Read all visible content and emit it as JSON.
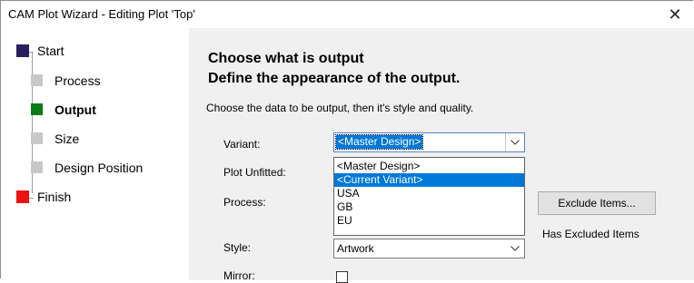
{
  "window": {
    "title": "CAM Plot Wizard - Editing Plot 'Top'",
    "close_glyph": "✕"
  },
  "steps": [
    {
      "label": "Start",
      "color": "#2a1f5e",
      "bold": false
    },
    {
      "label": "Process",
      "color": "#c8c8c8",
      "bold": false
    },
    {
      "label": "Output",
      "color": "#0a7a16",
      "bold": true
    },
    {
      "label": "Size",
      "color": "#c8c8c8",
      "bold": false
    },
    {
      "label": "Design Position",
      "color": "#c8c8c8",
      "bold": false
    },
    {
      "label": "Finish",
      "color": "#ee1111",
      "bold": false
    }
  ],
  "main": {
    "heading1": "Choose what is output",
    "heading2": "Define the appearance of the output.",
    "description": "Choose the data to be output, then it's style and quality."
  },
  "form": {
    "variant_label": "Variant:",
    "variant_value": "<Master Design>",
    "variant_options": [
      "<Master Design>",
      "<Current Variant>",
      "USA",
      "GB",
      "EU"
    ],
    "variant_highlighted": "<Current Variant>",
    "plot_unfitted_label": "Plot Unfitted:",
    "process_label": "Process:",
    "exclude_button": "Exclude Items...",
    "excluded_status": "Has Excluded Items",
    "style_label": "Style:",
    "style_value": "Artwork",
    "mirror_label": "Mirror:"
  }
}
